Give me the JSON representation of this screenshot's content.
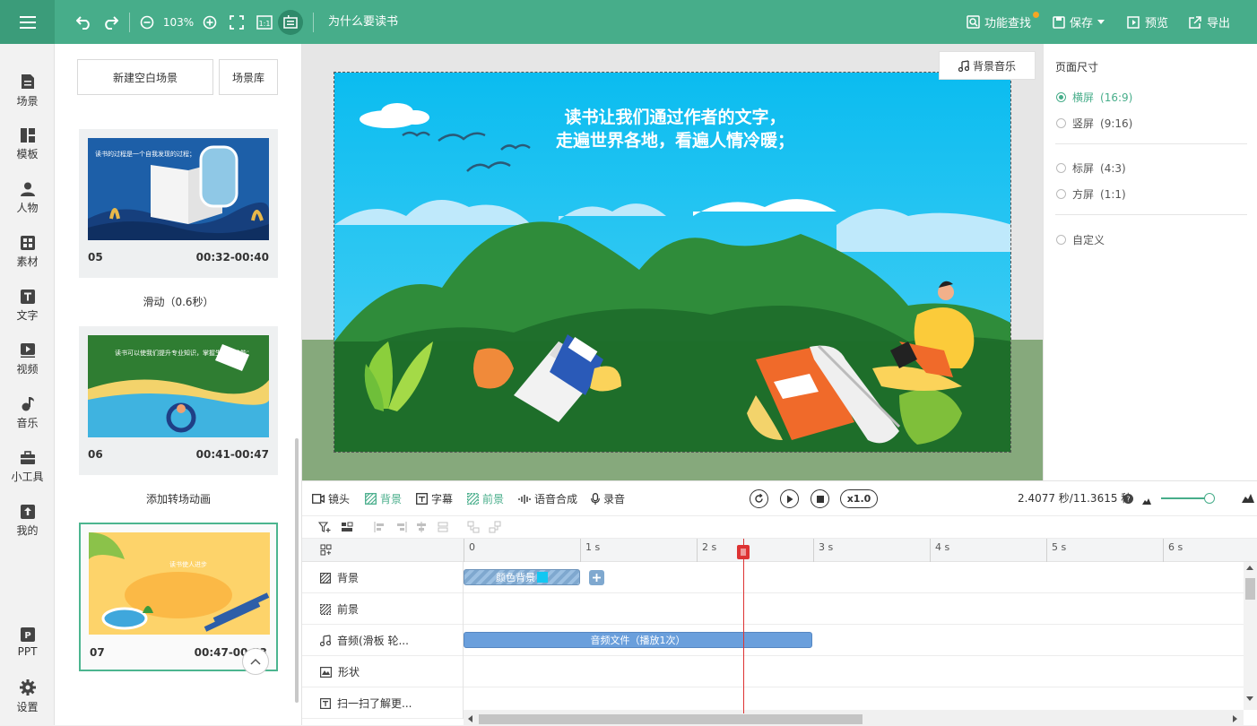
{
  "topbar": {
    "zoom": "103%",
    "doc_title": "为什么要读书",
    "find": "功能查找",
    "save": "保存",
    "preview": "预览",
    "export": "导出"
  },
  "sidebar": [
    {
      "label": "场景",
      "icon": "scene-icon"
    },
    {
      "label": "模板",
      "icon": "template-icon"
    },
    {
      "label": "人物",
      "icon": "person-icon"
    },
    {
      "label": "素材",
      "icon": "material-icon"
    },
    {
      "label": "文字",
      "icon": "text-icon"
    },
    {
      "label": "视频",
      "icon": "video-icon"
    },
    {
      "label": "音乐",
      "icon": "music-icon"
    },
    {
      "label": "小工具",
      "icon": "toolbox-icon"
    },
    {
      "label": "我的",
      "icon": "upload-icon"
    },
    {
      "label": "PPT",
      "icon": "ppt-icon"
    },
    {
      "label": "设置",
      "icon": "gear-icon"
    }
  ],
  "scenes": {
    "new_blank": "新建空白场景",
    "library": "场景库",
    "items": [
      {
        "num": "05",
        "time": "00:32-00:40",
        "thumb_text": "读书的过程是一个自我发现的过程；"
      },
      {
        "num": "06",
        "time": "00:41-00:47",
        "thumb_text": "读书可以使我们提升专业知识，掌握生存的技能；"
      },
      {
        "num": "07",
        "time": "00:47-00:53",
        "thumb_text": "读书使人进步"
      }
    ],
    "transitions": [
      "滑动（0.6秒）",
      "添加转场动画"
    ]
  },
  "canvas": {
    "bg_music": "背景音乐",
    "text_line1": "读书让我们通过作者的文字，",
    "text_line2": "走遍世界各地，看遍人情冷暖；"
  },
  "page_size": {
    "title": "页面尺寸",
    "options": [
      {
        "label": "横屏",
        "ratio": "(16:9)"
      },
      {
        "label": "竖屏",
        "ratio": "(9:16)"
      },
      {
        "label": "标屏",
        "ratio": "(4:3)"
      },
      {
        "label": "方屏",
        "ratio": "(1:1)"
      },
      {
        "label": "自定义",
        "ratio": ""
      }
    ],
    "selected": "横屏"
  },
  "timeline": {
    "tools": [
      "镜头",
      "背景",
      "字幕",
      "前景",
      "语音合成",
      "录音"
    ],
    "speed": "x1.0",
    "time": "2.4077 秒/11.3615 秒",
    "ruler": [
      "0",
      "1 s",
      "2 s",
      "3 s",
      "4 s",
      "5 s",
      "6 s"
    ],
    "tracks": [
      "背景",
      "前景",
      "音频(滑板 轮...",
      "形状",
      "扫一扫了解更..."
    ],
    "clip_bg": "颜色背景",
    "clip_audio": "音频文件（播放1次）",
    "playhead_seconds": 2.4077
  }
}
